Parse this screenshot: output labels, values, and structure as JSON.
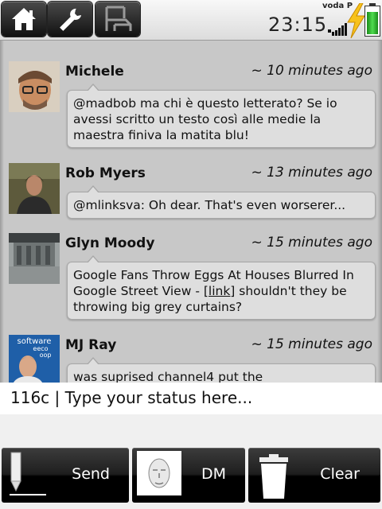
{
  "topbar": {
    "buttons": [
      {
        "icon": "home-icon"
      },
      {
        "icon": "wrench-icon"
      },
      {
        "icon": "chair-icon"
      }
    ],
    "clock": "23:15",
    "carrier": "voda P",
    "icons": {
      "signal": "signal-bars-icon",
      "charging": "lightning-bolt-icon",
      "battery": "battery-icon"
    },
    "battery_level": 0.85
  },
  "timeline": [
    {
      "author": "Michele",
      "time": "~ 10 minutes ago",
      "text": "@madbob ma chi è questo letterato? Se io avessi scritto un testo così alle medie la maestra finiva la matita blu!"
    },
    {
      "author": "Rob Myers",
      "time": "~ 13 minutes ago",
      "text": "@mlinksva: Oh dear. That's even worserer..."
    },
    {
      "author": "Glyn Moody",
      "time": "~ 15 minutes ago",
      "text_before_link": "Google Fans Throw Eggs At Houses Blurred In Google Street View - ",
      "link": "[link]",
      "text_after_link": "  shouldn't they be throwing big grey curtains?"
    },
    {
      "author": "MJ Ray",
      "time": "~ 15 minutes ago",
      "avatar_text": [
        "software",
        "eeco",
        "oop"
      ],
      "text": "was suprised channel4 put the"
    }
  ],
  "status_input": {
    "char_count": "116c",
    "separator": " | ",
    "placeholder": "Type your status here..."
  },
  "actions": {
    "send": "Send",
    "dm": "DM",
    "clear": "Clear"
  },
  "colors": {
    "background": "#c9c9c9",
    "bubble": "#dedede",
    "button": "#1e1e1e",
    "bolt": "#f7c21a",
    "battery": "#2fbf2f"
  }
}
